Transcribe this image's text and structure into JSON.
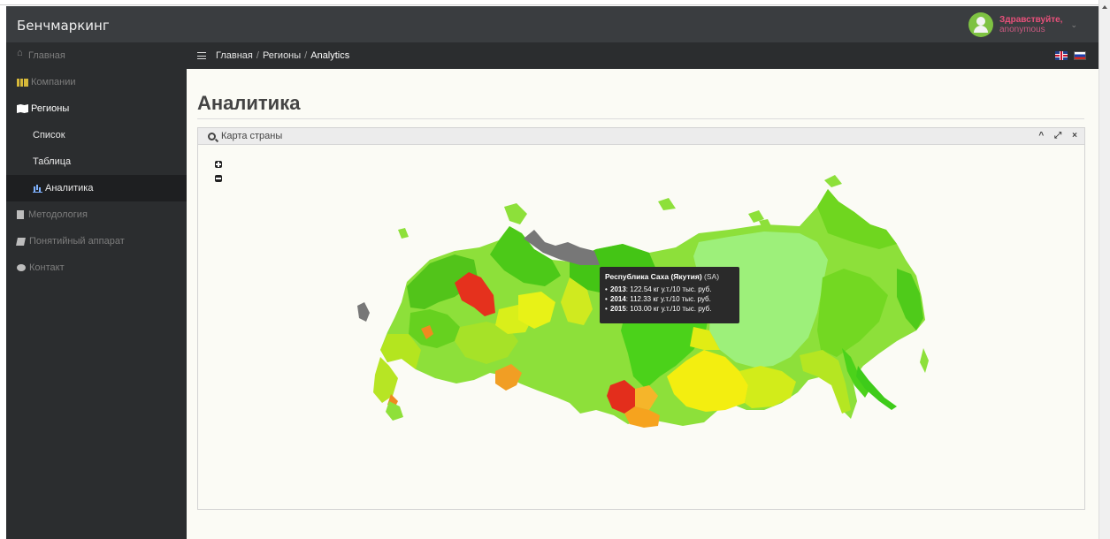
{
  "app": {
    "brand": "Бенчмаркинг",
    "user_greeting": "Здравствуйте,",
    "user_name": "anonymous"
  },
  "sidebar": {
    "items": [
      {
        "label": "Главная",
        "icon": "home-icon"
      },
      {
        "label": "Компании",
        "icon": "bar-chart-icon"
      },
      {
        "label": "Регионы",
        "icon": "map-icon"
      },
      {
        "label": "Список"
      },
      {
        "label": "Таблица"
      },
      {
        "label": "Аналитика",
        "icon": "bar-chart-icon"
      },
      {
        "label": "Методология",
        "icon": "file-icon"
      },
      {
        "label": "Понятийный аппарат",
        "icon": "book-icon"
      },
      {
        "label": "Контакт",
        "icon": "comment-icon"
      }
    ]
  },
  "breadcrumb": {
    "items": [
      "Главная",
      "Регионы",
      "Analytics"
    ]
  },
  "page": {
    "title": "Аналитика"
  },
  "panel": {
    "title": "Карта страны",
    "tools": [
      "^",
      "⤢",
      "×"
    ]
  },
  "tooltip": {
    "region": "Республика Саха (Якутия)",
    "code": "(SA)",
    "rows": [
      {
        "year": "2013",
        "value": ": 122.54 кг у.т./10 тыс. руб."
      },
      {
        "year": "2014",
        "value": ": 112.33 кг у.т./10 тыс. руб."
      },
      {
        "year": "2015",
        "value": ": 103.00 кг у.т./10 тыс. руб."
      }
    ]
  },
  "colors": {
    "topbar": "#3a3d40",
    "sidebar": "#2b2d2f",
    "high": "#e8301c",
    "mid": "#f5a623",
    "yellow": "#f5ec1a",
    "low": "#7ed321",
    "lowest": "#3ecb1a",
    "nodata": "#777777"
  }
}
